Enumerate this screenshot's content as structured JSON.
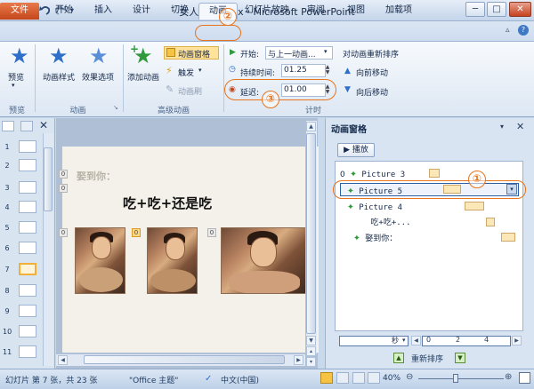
{
  "window": {
    "title": "女人天下.pptx - Microsoft PowerPoint",
    "buttons": {
      "minimize": "─",
      "maximize": "□",
      "close": "✕"
    }
  },
  "quick_access": [
    "save-icon",
    "undo-icon",
    "redo-icon"
  ],
  "tabs": [
    {
      "label": "文件"
    },
    {
      "label": "开始"
    },
    {
      "label": "插入"
    },
    {
      "label": "设计"
    },
    {
      "label": "切换"
    },
    {
      "label": "动画"
    },
    {
      "label": "幻灯片放映"
    },
    {
      "label": "审阅"
    },
    {
      "label": "视图"
    },
    {
      "label": "加载项"
    }
  ],
  "markers": {
    "one": "①",
    "two": "②",
    "three": "③"
  },
  "ribbon": {
    "preview": {
      "button": "预览",
      "group": "预览"
    },
    "animation": {
      "styles": "动画样式",
      "effects": "效果选项",
      "group": "动画"
    },
    "advanced": {
      "add": "添加动画",
      "pane": "动画窗格",
      "trigger": "触发",
      "painter": "动画刷",
      "group": "高级动画"
    },
    "timing": {
      "start_label": "开始:",
      "start_value": "与上一动画...",
      "duration_label": "持续时间:",
      "duration_value": "01.25",
      "delay_label": "延迟:",
      "delay_value": "01.00",
      "group": "计时"
    },
    "reorder": {
      "title": "对动画重新排序",
      "forward": "向前移动",
      "backward": "向后移动"
    }
  },
  "thumbnails": [
    "1",
    "2",
    "3",
    "4",
    "5",
    "6",
    "7",
    "8",
    "9",
    "10",
    "11"
  ],
  "selected_slide": "7",
  "slide": {
    "heading": "娶到你：",
    "title": "吃+吃+还是吃",
    "badge_0": "0",
    "badge_1": "0"
  },
  "anim_pane": {
    "title": "动画窗格",
    "play": "播放",
    "items": [
      {
        "num": "0",
        "name": "Picture 3"
      },
      {
        "num": "",
        "name": "Picture 5"
      },
      {
        "num": "",
        "name": "Picture 4"
      },
      {
        "num": "",
        "name": "吃+吃+..."
      },
      {
        "num": "",
        "name": "娶到你："
      }
    ],
    "timeline_unit": "秒",
    "timeline_ticks": [
      "0",
      "2",
      "4"
    ],
    "reorder_label": "重新排序"
  },
  "status": {
    "slide_info": "幻灯片 第 7 张，共 23 张",
    "theme": "\"Office 主题\"",
    "language": "中文(中国)",
    "zoom": "40%"
  },
  "colors": {
    "accent_orange": "#e8741e",
    "file_tab": "#c5471a",
    "ribbon_bg": "#f7fafd"
  }
}
